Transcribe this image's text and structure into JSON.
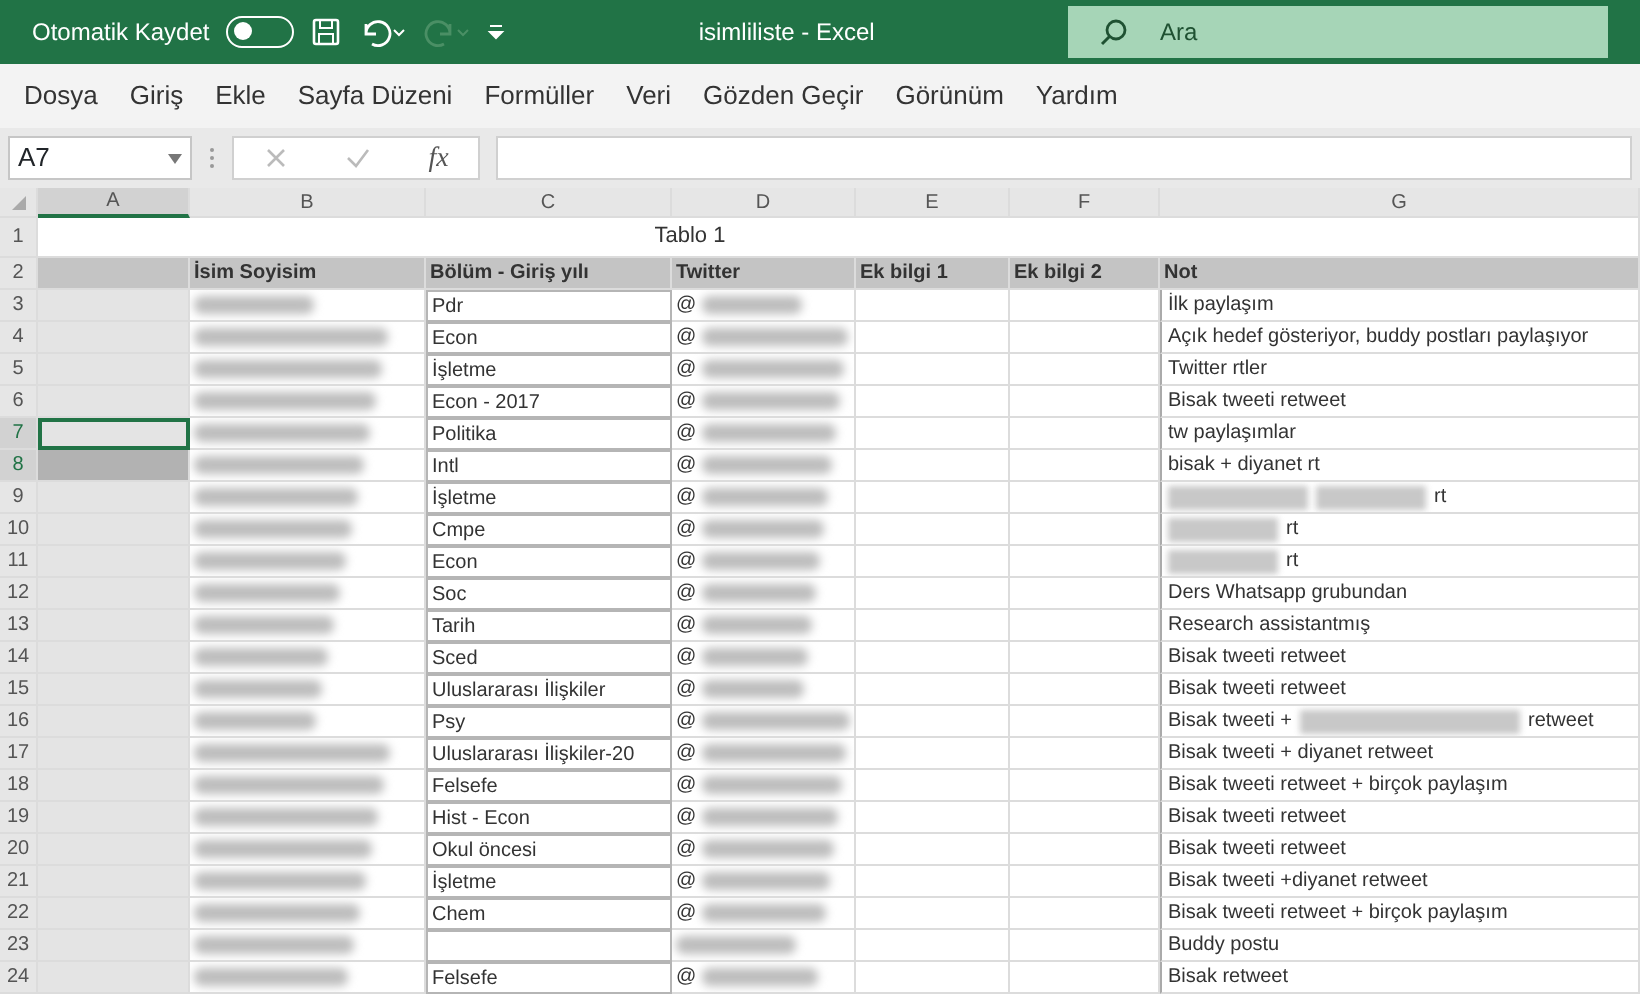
{
  "title_bar": {
    "autosave_label": "Otomatik Kaydet",
    "autosave_on": false,
    "redo_disabled": true,
    "title": "isimliliste  -  Excel",
    "search": {
      "placeholder": "Ara"
    }
  },
  "menu": [
    "Dosya",
    "Giriş",
    "Ekle",
    "Sayfa Düzeni",
    "Formüller",
    "Veri",
    "Gözden Geçir",
    "Görünüm",
    "Yardım"
  ],
  "formula_bar": {
    "name_box": "A7",
    "fx": "fx"
  },
  "columns": [
    {
      "letter": "A",
      "selected": true
    },
    {
      "letter": "B",
      "selected": false
    },
    {
      "letter": "C",
      "selected": false
    },
    {
      "letter": "D",
      "selected": false
    },
    {
      "letter": "E",
      "selected": false
    },
    {
      "letter": "F",
      "selected": false
    },
    {
      "letter": "G",
      "selected": false
    }
  ],
  "title_row": {
    "number": "1",
    "text": "Tablo 1"
  },
  "header_row": {
    "number": "2",
    "headers": [
      "İsim Soyisim",
      "Bölüm - Giriş yılı",
      "Twitter",
      "Ek bilgi 1",
      "Ek bilgi 2",
      "Not"
    ]
  },
  "rows": [
    {
      "number": "3",
      "selected": false,
      "active": false,
      "name_redacted": true,
      "department": "Pdr",
      "twitter": "@",
      "twitter_redacted": true,
      "note": [
        {
          "kind": "text",
          "text": "İlk paylaşım"
        }
      ]
    },
    {
      "number": "4",
      "selected": false,
      "active": false,
      "name_redacted": true,
      "department": "Econ",
      "twitter": "@",
      "twitter_redacted": true,
      "note": [
        {
          "kind": "text",
          "text": "Açık hedef gösteriyor, buddy postları paylaşıyor"
        }
      ]
    },
    {
      "number": "5",
      "selected": false,
      "active": false,
      "name_redacted": true,
      "department": "İşletme",
      "twitter": "@",
      "twitter_redacted": true,
      "note": [
        {
          "kind": "text",
          "text": "Twitter rtler"
        }
      ]
    },
    {
      "number": "6",
      "selected": false,
      "active": false,
      "name_redacted": true,
      "department": "Econ - 2017",
      "twitter": "@",
      "twitter_redacted": true,
      "note": [
        {
          "kind": "text",
          "text": "Bisak tweeti retweet"
        }
      ]
    },
    {
      "number": "7",
      "selected": true,
      "active": true,
      "name_redacted": true,
      "department": "Politika",
      "twitter": "@",
      "twitter_redacted": true,
      "note": [
        {
          "kind": "text",
          "text": "tw paylaşımlar"
        }
      ]
    },
    {
      "number": "8",
      "selected": true,
      "active": false,
      "name_redacted": true,
      "department": "Intl",
      "twitter": "@",
      "twitter_redacted": true,
      "note": [
        {
          "kind": "text",
          "text": "bisak + diyanet rt"
        }
      ]
    },
    {
      "number": "9",
      "selected": false,
      "active": false,
      "name_redacted": true,
      "department": "İşletme",
      "twitter": "@",
      "twitter_redacted": true,
      "note": [
        {
          "kind": "blur"
        },
        {
          "kind": "blur"
        },
        {
          "kind": "text",
          "text": "rt"
        }
      ]
    },
    {
      "number": "10",
      "selected": false,
      "active": false,
      "name_redacted": true,
      "department": "Cmpe",
      "twitter": "@",
      "twitter_redacted": true,
      "note": [
        {
          "kind": "blur"
        },
        {
          "kind": "text",
          "text": "rt"
        }
      ]
    },
    {
      "number": "11",
      "selected": false,
      "active": false,
      "name_redacted": true,
      "department": "Econ",
      "twitter": "@",
      "twitter_redacted": true,
      "note": [
        {
          "kind": "blur"
        },
        {
          "kind": "text",
          "text": "rt"
        }
      ]
    },
    {
      "number": "12",
      "selected": false,
      "active": false,
      "name_redacted": true,
      "department": "Soc",
      "twitter": "@",
      "twitter_redacted": true,
      "note": [
        {
          "kind": "text",
          "text": "Ders Whatsapp grubundan"
        }
      ]
    },
    {
      "number": "13",
      "selected": false,
      "active": false,
      "name_redacted": true,
      "department": "Tarih",
      "twitter": "@",
      "twitter_redacted": true,
      "note": [
        {
          "kind": "text",
          "text": "Research assistantmış"
        }
      ]
    },
    {
      "number": "14",
      "selected": false,
      "active": false,
      "name_redacted": true,
      "department": "Sced",
      "twitter": "@",
      "twitter_redacted": true,
      "note": [
        {
          "kind": "text",
          "text": "Bisak tweeti retweet"
        }
      ]
    },
    {
      "number": "15",
      "selected": false,
      "active": false,
      "name_redacted": true,
      "department": "Uluslararası İlişkiler",
      "twitter": "@",
      "twitter_redacted": true,
      "note": [
        {
          "kind": "text",
          "text": "Bisak tweeti retweet"
        }
      ]
    },
    {
      "number": "16",
      "selected": false,
      "active": false,
      "name_redacted": true,
      "department": "Psy",
      "twitter": "@",
      "twitter_redacted": true,
      "note": [
        {
          "kind": "text",
          "text": "Bisak tweeti +"
        },
        {
          "kind": "blur"
        },
        {
          "kind": "text",
          "text": "retweet"
        }
      ]
    },
    {
      "number": "17",
      "selected": false,
      "active": false,
      "name_redacted": true,
      "department": "Uluslararası İlişkiler-20",
      "twitter": "@",
      "twitter_redacted": true,
      "note": [
        {
          "kind": "text",
          "text": "Bisak tweeti + diyanet retweet"
        }
      ]
    },
    {
      "number": "18",
      "selected": false,
      "active": false,
      "name_redacted": true,
      "department": "Felsefe",
      "twitter": "@",
      "twitter_redacted": true,
      "note": [
        {
          "kind": "text",
          "text": "Bisak tweeti retweet + birçok paylaşım"
        }
      ]
    },
    {
      "number": "19",
      "selected": false,
      "active": false,
      "name_redacted": true,
      "department": "Hist - Econ",
      "twitter": "@",
      "twitter_redacted": true,
      "note": [
        {
          "kind": "text",
          "text": "Bisak tweeti retweet"
        }
      ]
    },
    {
      "number": "20",
      "selected": false,
      "active": false,
      "name_redacted": true,
      "department": "Okul öncesi",
      "twitter": "@",
      "twitter_redacted": true,
      "note": [
        {
          "kind": "text",
          "text": "Bisak tweeti retweet"
        }
      ]
    },
    {
      "number": "21",
      "selected": false,
      "active": false,
      "name_redacted": true,
      "department": "İşletme",
      "twitter": "@",
      "twitter_redacted": true,
      "note": [
        {
          "kind": "text",
          "text": "Bisak tweeti +diyanet retweet"
        }
      ]
    },
    {
      "number": "22",
      "selected": false,
      "active": false,
      "name_redacted": true,
      "department": "Chem",
      "twitter": "@",
      "twitter_redacted": true,
      "note": [
        {
          "kind": "text",
          "text": "Bisak tweeti retweet + birçok paylaşım"
        }
      ]
    },
    {
      "number": "23",
      "selected": false,
      "active": false,
      "name_redacted": true,
      "twitter_redacted": true,
      "note": [
        {
          "kind": "text",
          "text": "Buddy postu"
        }
      ]
    },
    {
      "number": "24",
      "selected": false,
      "active": false,
      "name_redacted": true,
      "department": "Felsefe",
      "twitter": "@",
      "twitter_redacted": true,
      "note": [
        {
          "kind": "text",
          "text": "Bisak retweet"
        }
      ]
    }
  ]
}
